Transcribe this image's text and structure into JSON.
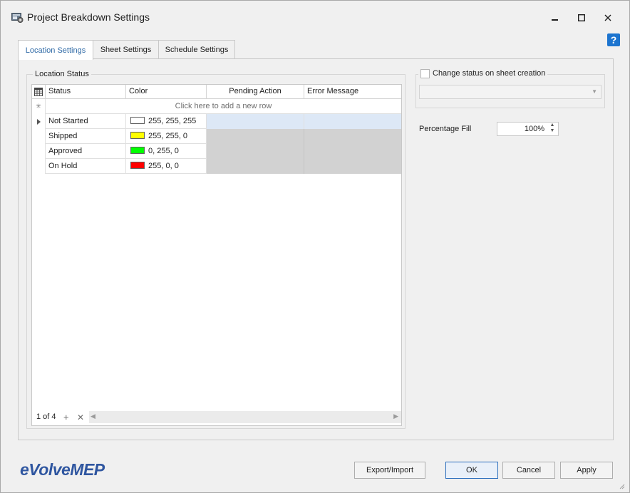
{
  "window": {
    "title": "Project Breakdown Settings",
    "minimize_icon": "minimize-icon",
    "maximize_icon": "maximize-icon",
    "close_icon": "close-icon"
  },
  "tabs": [
    {
      "label": "Location Settings",
      "active": true
    },
    {
      "label": "Sheet Settings",
      "active": false
    },
    {
      "label": "Schedule Settings",
      "active": false
    }
  ],
  "location_status": {
    "group_label": "Location Status",
    "columns": [
      "Status",
      "Color",
      "Pending Action",
      "Error Message"
    ],
    "new_row_text": "Click here to add a new row",
    "rows": [
      {
        "status": "Not Started",
        "color_text": "255, 255, 255",
        "swatch": "#ffffff",
        "selected": true
      },
      {
        "status": "Shipped",
        "color_text": "255, 255, 0",
        "swatch": "#ffff00",
        "selected": false
      },
      {
        "status": "Approved",
        "color_text": "0, 255, 0",
        "swatch": "#00ff00",
        "selected": false
      },
      {
        "status": "On Hold",
        "color_text": "255, 0, 0",
        "swatch": "#ff0000",
        "selected": false
      }
    ],
    "navigator": {
      "record_text": "1 of 4",
      "add_glyph": "+",
      "remove_glyph": "✕"
    }
  },
  "sheet_creation": {
    "checkbox_label": "Change status on sheet creation",
    "checked": false,
    "combo_value": ""
  },
  "percentage_fill": {
    "label": "Percentage Fill",
    "value": "100%"
  },
  "footer": {
    "logo_lower": "e",
    "logo_rest": "VolveMEP",
    "export_import": "Export/Import",
    "ok": "OK",
    "cancel": "Cancel",
    "apply": "Apply"
  },
  "colors": {
    "accent": "#2f6aa6",
    "help_blue": "#1c74cf",
    "logo_blue": "#2f56a0",
    "disabled_cell": "#d2d2d2",
    "selected_cell": "#dde8f6"
  }
}
